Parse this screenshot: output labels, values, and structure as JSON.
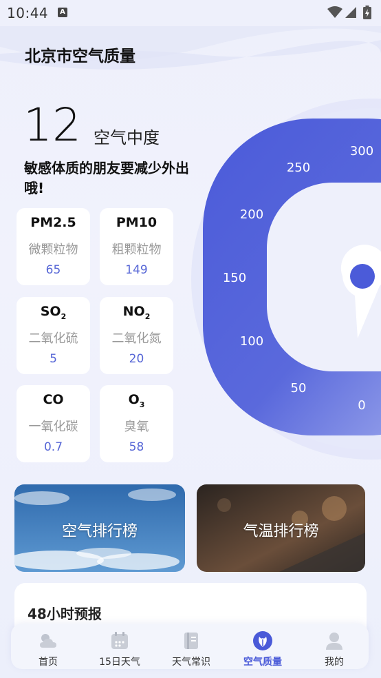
{
  "status_bar": {
    "time": "10:44",
    "notification_glyph": "A"
  },
  "header": {
    "title": "北京市空气质量"
  },
  "aqi": {
    "value": "12",
    "level": "空气中度",
    "advice": "敏感体质的朋友要减少外出哦!"
  },
  "pollutants": [
    {
      "symbol": "PM2.5",
      "sub": "",
      "name": "微颗粒物",
      "value": "65"
    },
    {
      "symbol": "PM10",
      "sub": "",
      "name": "粗颗粒物",
      "value": "149"
    },
    {
      "symbol": "SO",
      "sub": "2",
      "name": "二氧化硫",
      "value": "5"
    },
    {
      "symbol": "NO",
      "sub": "2",
      "name": "二氧化氮",
      "value": "20"
    },
    {
      "symbol": "CO",
      "sub": "",
      "name": "一氧化碳",
      "value": "0.7"
    },
    {
      "symbol": "O",
      "sub": "3",
      "name": "臭氧",
      "value": "58"
    }
  ],
  "gauge": {
    "scale_labels": [
      "300",
      "250",
      "200",
      "150",
      "100",
      "50",
      "0"
    ],
    "color_dark": "#4b5bd9",
    "color_light": "#aab4ef"
  },
  "banners": {
    "air_ranking": "空气排行榜",
    "temp_ranking": "气温排行榜"
  },
  "forecast": {
    "title": "48小时预报"
  },
  "tabs": [
    {
      "label": "首页",
      "icon": "weather-icon"
    },
    {
      "label": "15日天气",
      "icon": "calendar-icon"
    },
    {
      "label": "天气常识",
      "icon": "book-icon"
    },
    {
      "label": "空气质量",
      "icon": "leaf-icon",
      "active": true
    },
    {
      "label": "我的",
      "icon": "user-icon"
    }
  ]
}
